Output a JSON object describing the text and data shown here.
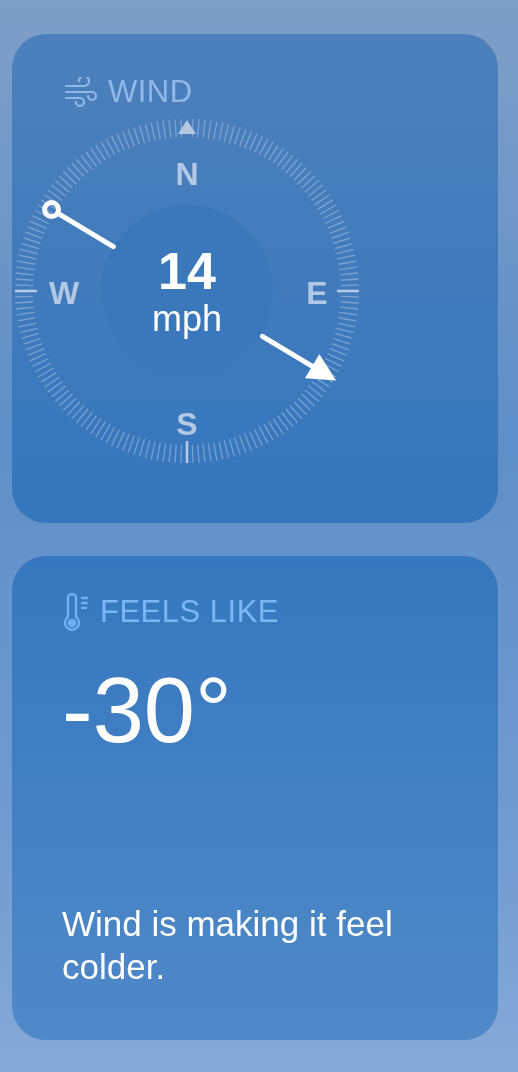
{
  "wind": {
    "title": "WIND",
    "speed": "14",
    "unit": "mph",
    "directions": [
      {
        "label": "N",
        "kind": "north"
      },
      {
        "label": "E",
        "kind": "east"
      },
      {
        "label": "S",
        "kind": "south"
      },
      {
        "label": "W",
        "kind": "west"
      }
    ]
  },
  "feels_like": {
    "title": "FEELS LIKE",
    "value": "-30°",
    "description": "Wind is making it feel colder."
  }
}
